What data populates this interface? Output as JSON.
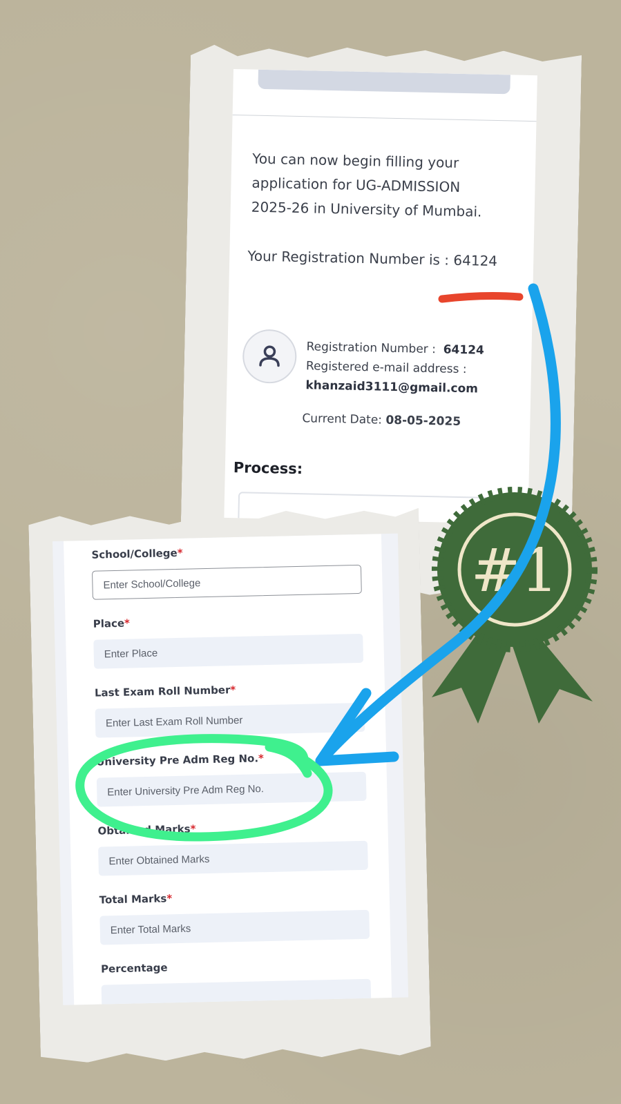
{
  "top_screen": {
    "message": "You can now begin filling your application for UG-ADMISSION 2025-26 in University of Mumbai.",
    "registration_sentence": "Your Registration Number is : 64124",
    "registration_label": "Registration Number :",
    "registration_number": "64124",
    "email_label": "Registered e-mail address :",
    "email": "khanzaid3111@gmail.com",
    "date_label": "Current Date:",
    "date": "08-05-2025",
    "process_label": "Process:"
  },
  "form": {
    "fields": [
      {
        "label": "School/College",
        "placeholder": "Enter School/College",
        "required": "*"
      },
      {
        "label": "Place",
        "placeholder": "Enter Place",
        "required": "*"
      },
      {
        "label": "Last Exam Roll Number",
        "placeholder": "Enter Last Exam Roll Number",
        "required": "*"
      },
      {
        "label": "University Pre Adm Reg No.",
        "placeholder": "Enter University Pre Adm Reg No.",
        "required": "*"
      },
      {
        "label": "Obtained Marks",
        "placeholder": "Enter Obtained Marks",
        "required": "*"
      },
      {
        "label": "Total Marks",
        "placeholder": "Enter Total Marks",
        "required": "*"
      },
      {
        "label": "Percentage",
        "placeholder": "",
        "required": ""
      }
    ]
  },
  "badge": {
    "text": "#1",
    "color": "#3f6b3a",
    "accent": "#efe6c8"
  },
  "colors": {
    "red_underline": "#e8452c",
    "blue_arrow": "#1aa3ec",
    "green_circle": "#3ff08e"
  },
  "icons": [
    "user-icon"
  ]
}
